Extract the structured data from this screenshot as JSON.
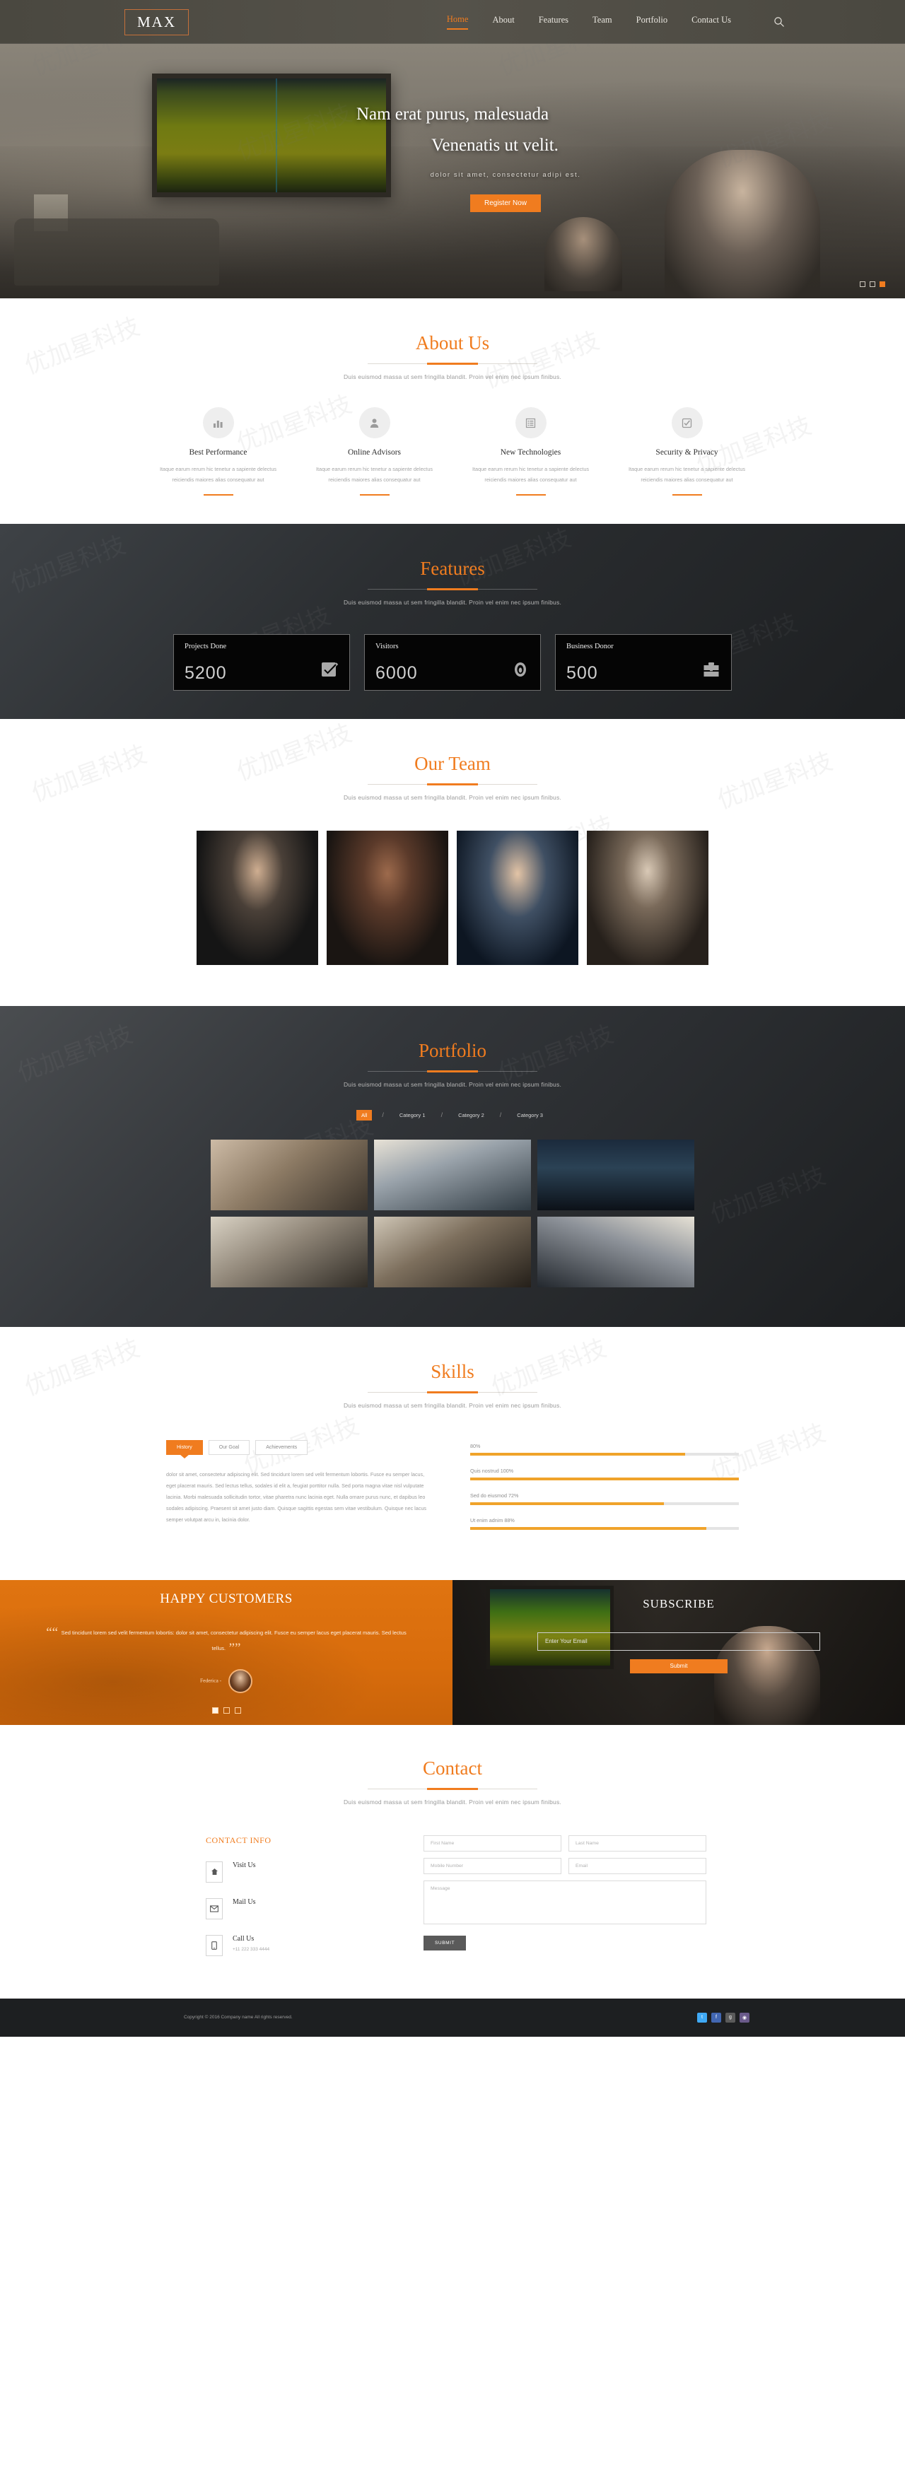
{
  "header": {
    "logo": "MAX",
    "nav": [
      {
        "label": "Home",
        "active": true
      },
      {
        "label": "About",
        "active": false
      },
      {
        "label": "Features",
        "active": false
      },
      {
        "label": "Team",
        "active": false
      },
      {
        "label": "Portfolio",
        "active": false
      },
      {
        "label": "Contact Us",
        "active": false
      }
    ],
    "search_icon": "search-icon"
  },
  "hero": {
    "title_line1": "Nam erat purus, malesuada",
    "title_line2": "Venenatis ut velit.",
    "subtitle": "dolor sit amet, consectetur adipi est.",
    "button": "Register Now",
    "slide_dots": 3,
    "active_dot": 3
  },
  "about": {
    "title": "About Us",
    "subtitle": "Duis euismod massa ut sem fringilla blandit. Proin vel enim nec ipsum finibus.",
    "cards": [
      {
        "icon": "bar-chart-icon",
        "title": "Best Performance",
        "text": "Itaque earum rerum hic tenetur a sapiente delectus reiciendis maiores alias consequatur aut"
      },
      {
        "icon": "user-icon",
        "title": "Online Advisors",
        "text": "Itaque earum rerum hic tenetur a sapiente delectus reiciendis maiores alias consequatur aut"
      },
      {
        "icon": "list-icon",
        "title": "New Technologies",
        "text": "Itaque earum rerum hic tenetur a sapiente delectus reiciendis maiores alias consequatur aut"
      },
      {
        "icon": "check-square-icon",
        "title": "Security & Privacy",
        "text": "Itaque earum rerum hic tenetur a sapiente delectus reiciendis maiores alias consequatur aut"
      }
    ]
  },
  "features": {
    "title": "Features",
    "subtitle": "Duis euismod massa ut sem fringilla blandit. Proin vel enim nec ipsum finibus.",
    "counters": [
      {
        "label": "Projects Done",
        "value": "5200",
        "icon": "check-square-icon"
      },
      {
        "label": "Visitors",
        "value": "6000",
        "icon": "eye-icon"
      },
      {
        "label": "Business Donor",
        "value": "500",
        "icon": "briefcase-icon"
      }
    ]
  },
  "team": {
    "title": "Our Team",
    "subtitle": "Duis euismod massa ut sem fringilla blandit. Proin vel enim nec ipsum finibus.",
    "members": [
      "member-photo-1",
      "member-photo-2",
      "member-photo-3",
      "member-photo-4"
    ]
  },
  "portfolio": {
    "title": "Portfolio",
    "subtitle": "Duis euismod massa ut sem fringilla blandit. Proin vel enim nec ipsum finibus.",
    "filters": [
      {
        "label": "All",
        "active": true
      },
      {
        "label": "Category 1",
        "active": false
      },
      {
        "label": "Category 2",
        "active": false
      },
      {
        "label": "Category 3",
        "active": false
      }
    ],
    "items": [
      "portfolio-1",
      "portfolio-2",
      "portfolio-3",
      "portfolio-4",
      "portfolio-5",
      "portfolio-6"
    ]
  },
  "skills": {
    "title": "Skills",
    "subtitle": "Duis euismod massa ut sem fringilla blandit. Proin vel enim nec ipsum finibus.",
    "tabs": [
      {
        "label": "History",
        "active": true
      },
      {
        "label": "Our Goal",
        "active": false
      },
      {
        "label": "Achievements",
        "active": false
      }
    ],
    "body": "dolor sit amet, consectetur adipiscing elit. Sed tincidunt lorem sed velit fermentum lobortis. Fusce eu semper lacus, eget placerat mauris. Sed lectus tellus, sodales id elit a, feugiat porttitor nulla. Sed porta magna vitae nisl vulputate lacinia. Morbi malesuada sollicitudin tortor, vitae pharetra nunc lacinia eget. Nulla ornare purus nunc, et dapibus leo sodales adipiscing. Praesent sit amet justo diam. Quisque sagittis egestas sem vitae vestibulum. Quisque nec lacus semper volutpat arcu in, lacinia dolor.",
    "bars": [
      {
        "label": "",
        "percent": "80%",
        "value": 80
      },
      {
        "label": "Quis nostrud",
        "percent": "100%",
        "value": 100
      },
      {
        "label": "Sed do eiusmod",
        "percent": "72%",
        "value": 72
      },
      {
        "label": "Ut enim adnim",
        "percent": "88%",
        "value": 88
      }
    ]
  },
  "testimonial": {
    "title": "HAPPY CUSTOMERS",
    "quote": "Sed tincidunt lorem sed velit fermentum lobortis: dolor sit amet, consectetur adipiscing elit. Fusce eu semper lacus eget placerat mauris. Sed lectus tellus.",
    "author": "Federica -",
    "dots": 3,
    "active_dot": 1
  },
  "subscribe": {
    "title": "SUBSCRIBE",
    "placeholder": "Enter Your Email",
    "value": "",
    "button": "Submit"
  },
  "contact": {
    "title": "Contact",
    "subtitle": "Duis euismod massa ut sem fringilla blandit. Proin vel enim nec ipsum finibus.",
    "info_title": "CONTACT INFO",
    "info": [
      {
        "icon": "home-icon",
        "label": "Visit Us",
        "value": ""
      },
      {
        "icon": "mail-icon",
        "label": "Mail Us",
        "value": ""
      },
      {
        "icon": "phone-icon",
        "label": "Call Us",
        "value": "+11 222 333 4444"
      }
    ],
    "form": {
      "first_name": "First Name",
      "last_name": "Last Name",
      "mobile": "Mobile Number",
      "email": "Email",
      "message": "Message",
      "submit": "SUBMIT"
    }
  },
  "footer": {
    "copyright": "Copyright © 2016 Company name All rights reserved.",
    "socials": [
      {
        "name": "twitter-icon",
        "glyph": "t"
      },
      {
        "name": "facebook-icon",
        "glyph": "f"
      },
      {
        "name": "google-plus-icon",
        "glyph": "g"
      },
      {
        "name": "instagram-icon",
        "glyph": "◉"
      }
    ]
  },
  "colors": {
    "accent": "#f07c1f",
    "dark": "#1d1f21",
    "muted": "#9a9a9a"
  }
}
